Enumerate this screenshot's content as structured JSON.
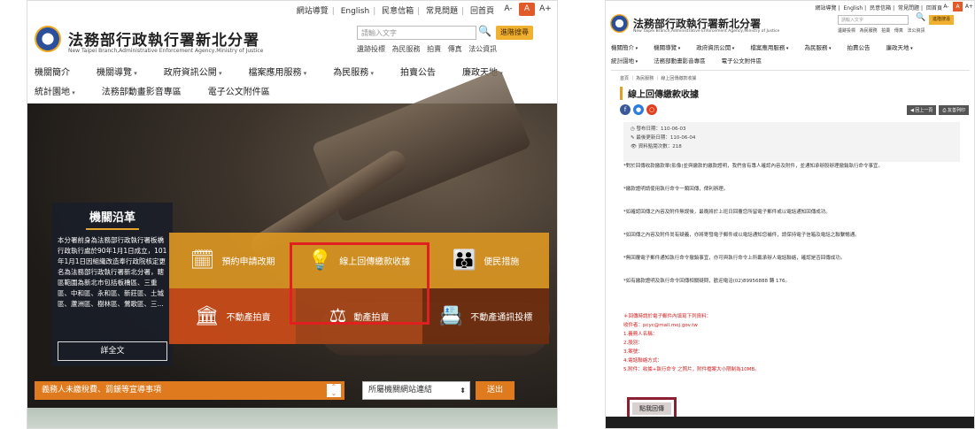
{
  "left": {
    "toplinks": [
      "網站導覽",
      "English",
      "民意信箱",
      "常見問題",
      "回首頁"
    ],
    "fontsize": [
      "A-",
      "A",
      "A+"
    ],
    "site_title": "法務部行政執行署新北分署",
    "site_subtitle": "New Taipei Branch,Administrative Enforcement Agency,Ministry of Justice",
    "search_placeholder": "請輸入文字",
    "search_button": "進階搜尋",
    "quick_links": [
      "遺跡投標",
      "為民服務",
      "拍賣",
      "傳真",
      "法公資訊"
    ],
    "nav_row1": [
      "機關簡介",
      "機關導覽",
      "政府資訊公開",
      "檔案應用服務",
      "為民服務",
      "拍賣公告",
      "廉政天地"
    ],
    "nav_row2": [
      "統計園地",
      "法務部動畫影音專區",
      "電子公文附件區"
    ],
    "history": {
      "title": "機關沿革",
      "text": "本分署前身為法務部行政執行署板橋行政執行處於90年1月1日成立，101年1月1日因組織改造奉行政院核定更名為法務部行政執行署新北分署，轄區範圍為新北市包括板橋區、三重區、中和區、永和區、新莊區、土城區、蘆洲區、樹林區、鶯歌區、三...",
      "more": "詳全文"
    },
    "tiles": [
      {
        "label": "預約申請改期",
        "icon": "🗓"
      },
      {
        "label": "線上回傳繳款收據",
        "icon": "💡"
      },
      {
        "label": "便民措施",
        "icon": "👪"
      },
      {
        "label": "不動產拍賣",
        "icon": "🏛"
      },
      {
        "label": "動產拍賣",
        "icon": "⚖"
      },
      {
        "label": "不動產通訊投標",
        "icon": "📇"
      }
    ],
    "notice": "義務人未繳稅費、罰鍰等宣導事項",
    "select_value": "所屬機關網站連結",
    "go_button": "送出"
  },
  "right": {
    "toplinks": [
      "網站導覽",
      "English",
      "民意信箱",
      "常見問題",
      "回首頁"
    ],
    "fontsize": [
      "A-",
      "A",
      "A+"
    ],
    "site_title": "法務部行政執行署新北分署",
    "site_subtitle": "New Taipei Branch,Administrative Enforcement Agency,Ministry of Justice",
    "search_placeholder": "請輸入文字",
    "search_button": "進階搜尋",
    "quick_links": [
      "遺跡投標",
      "為民服務",
      "拍賣",
      "傳真",
      "法公資訊"
    ],
    "nav_row1": [
      "機關簡介",
      "機關導覽",
      "政府資訊公開",
      "檔案應用服務",
      "為民服務",
      "拍賣公告",
      "廉政天地"
    ],
    "nav_row2": [
      "統計園地",
      "法務部動畫影音專區",
      "電子公文附件區"
    ],
    "breadcrumb": "首頁 ｜ 為民服務 ｜ 線上回傳繳款收據",
    "page_title": "線上回傳繳款收據",
    "actions": [
      "◀ 回上一頁",
      "⎙ 友善列印"
    ],
    "meta": [
      "◷ 發布日期：110-06-03",
      "✎ 最後更新日期：110-06-04",
      "👁 資料點閱次數：218"
    ],
    "paragraphs": [
      "*對於回傳收款繳款單(影像)並與繳款的繳款證明，我們會有專人確認內容及附件，並通知承辦股辦理撤銷執行命令事宜。",
      "*繳款證明請使用執行命令一類回傳，俾利辦理。",
      "*如確認回傳之內容及附件無誤後，最晚將於上班日回覆您所留電子郵件或以電話通知回傳成功。",
      "*如回傳之內容及附件尚有疑義，亦將寄發電子郵件或以電話通知您補件，請保持電子信箱及電話之聯繫暢通。",
      "*無回覆電子郵件通知執行命令撤銷事宜，亦可與執行命令上所載承辦人電話聯絡，確認是否回傳成功。",
      "*如有繳款證明及執行命令回傳相關疑問，歡迎電洽(02)89956888 轉 176。"
    ],
    "red_notes": [
      "＊回傳時請於電子郵件內填寫下列資料：",
      "收件者：pcyc@mail.moj.gov.tw",
      "1.義務人名稱：",
      "2.股別：",
      "3.案號：",
      "4.電話聯絡方式：",
      "5.附件：收據+執行命令 之照片，附件檔案大小限制為10MB。"
    ],
    "reply_button": "點我回傳"
  }
}
